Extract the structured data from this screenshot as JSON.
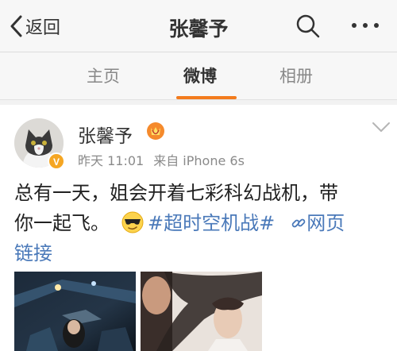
{
  "nav": {
    "back_label": "返回",
    "title": "张馨予"
  },
  "tabs": [
    {
      "label": "主页",
      "active": false
    },
    {
      "label": "微博",
      "active": true
    },
    {
      "label": "相册",
      "active": false
    }
  ],
  "post": {
    "username": "张馨予",
    "time": "昨天 11:01",
    "source": "来自 iPhone 6s",
    "text_line1": "总有一天，姐会开着七彩科幻战机，带",
    "text_line2": "你一起飞。",
    "hashtag": "#超时空机战#",
    "link_label": "网页",
    "link_label_cont": "链接"
  },
  "colors": {
    "accent_orange": "#f37b1d",
    "link_blue": "#4a79b9",
    "verified_badge": "#f5a623"
  },
  "icons": [
    "back-chevron-icon",
    "search-icon",
    "more-icon",
    "vip-badge-icon",
    "verified-badge-icon",
    "chevron-down-icon",
    "sunglasses-emoji-icon",
    "link-icon"
  ]
}
